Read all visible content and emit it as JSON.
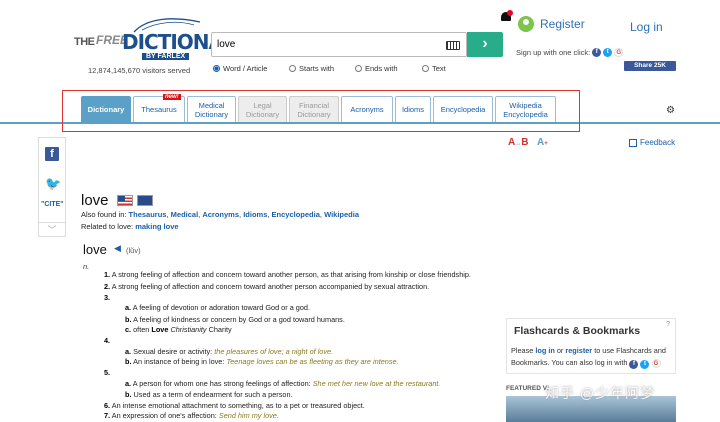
{
  "header": {
    "logo": {
      "the": "THE",
      "free": "FREE",
      "dictionary": "DICTIONARY",
      "by": "BY FARLEX"
    },
    "visitors": "12,874,145,670 visitors served",
    "search": {
      "value": "love",
      "placeholder": ""
    },
    "search_options": [
      "Word / Article",
      "Starts with",
      "Ends with",
      "Text"
    ],
    "selected_option": "Word / Article",
    "notification_count": "1",
    "register_label": "Register",
    "login_label": "Log in",
    "signup_text": "Sign up with one click:",
    "share_label": "Share 25K"
  },
  "tabs": [
    {
      "label": "Dictionary",
      "state": "active"
    },
    {
      "label": "Thesaurus",
      "state": "normal"
    },
    {
      "label": "Medical Dictionary",
      "state": "normal"
    },
    {
      "label": "Legal Dictionary",
      "state": "disabled"
    },
    {
      "label": "Financial Dictionary",
      "state": "disabled"
    },
    {
      "label": "Acronyms",
      "state": "normal"
    },
    {
      "label": "Idioms",
      "state": "normal"
    },
    {
      "label": "Encyclopedia",
      "state": "normal"
    },
    {
      "label": "Wikipedia Encyclopedia",
      "state": "normal"
    }
  ],
  "new_badge": "new!",
  "rail": {
    "cite": "\"CITE\""
  },
  "tools": {
    "font_a": "A",
    "font_b": "B",
    "font_c": "A",
    "feedback": "Feedback"
  },
  "entry": {
    "headword": "love",
    "found_in_label": "Also found in:",
    "found_in": [
      "Thesaurus",
      "Medical",
      "Acronyms",
      "Idioms",
      "Encyclopedia",
      "Wikipedia"
    ],
    "related_label": "Related to love:",
    "related": "making love",
    "word": "love",
    "pronunciation": "(lŭv)",
    "pos": "n.",
    "definitions": [
      {
        "n": "1.",
        "text": "A strong feeling of affection and concern toward another person, as that arising from kinship or close friendship."
      },
      {
        "n": "2.",
        "text": "A strong feeling of affection and concern toward another person accompanied by sexual attraction."
      },
      {
        "n": "3.",
        "text": ""
      },
      {
        "n": "a.",
        "text": "A feeling of devotion or adoration toward God or a god."
      },
      {
        "n": "b.",
        "text": "A feeling of kindness or concern by God or a god toward humans."
      },
      {
        "n": "c.",
        "text": "often",
        "bold": "Love",
        "italic": "Christianity",
        "rest": "Charity"
      },
      {
        "n": "4.",
        "text": ""
      },
      {
        "n": "a.",
        "text": "Sexual desire or activity:",
        "example": "the pleasures of love; a night of love."
      },
      {
        "n": "b.",
        "text": "An instance of being in love:",
        "example": "Teenage loves can be as fleeting as they are intense."
      },
      {
        "n": "5.",
        "text": ""
      },
      {
        "n": "a.",
        "text": "A person for whom one has strong feelings of affection:",
        "example": "She met her new love at the restaurant."
      },
      {
        "n": "b.",
        "text": "Used as a term of endearment for such a person."
      },
      {
        "n": "6.",
        "text": "An intense emotional attachment to something, as to a pet or treasured object."
      },
      {
        "n": "7.",
        "text": "An expression of one's affection:",
        "example": "Send him my love."
      }
    ]
  },
  "sidebar": {
    "flash_title": "Flashcards & Bookmarks",
    "flash_help": "?",
    "flash_text_1": "Please",
    "flash_login": "log in",
    "flash_text_2": "or",
    "flash_register": "register",
    "flash_text_3": "to use Flashcards and Bookmarks. You can also log in with",
    "featured": "FEATURED VI",
    "watermark": "知乎 @少年阿梦"
  },
  "colors": {
    "accent": "#5ba0c6",
    "link": "#1a5fa8",
    "search_button": "#27ad8a",
    "highlight": "#dd3333"
  }
}
